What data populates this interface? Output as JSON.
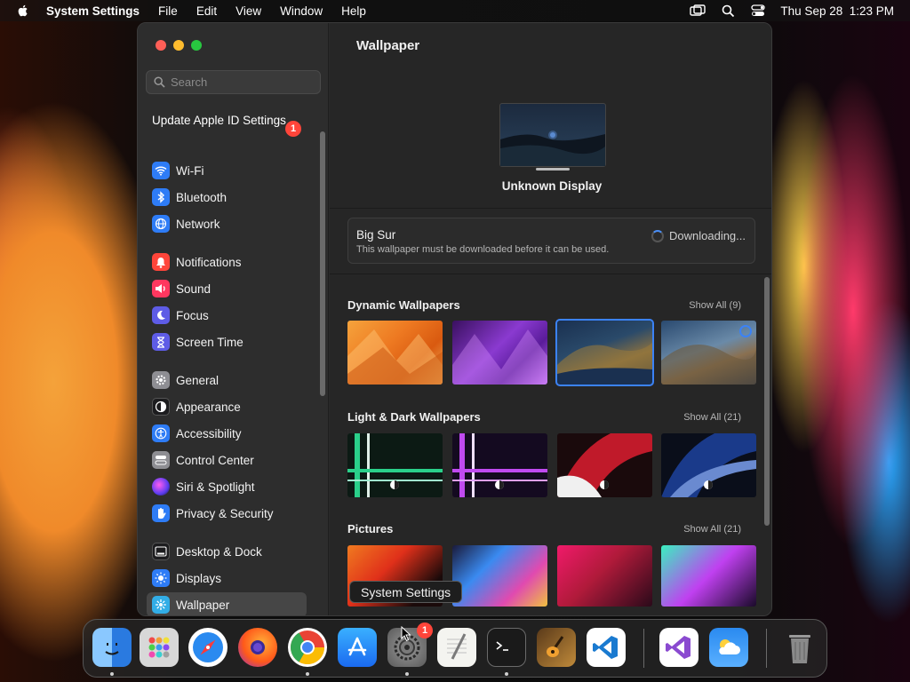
{
  "menubar": {
    "app_name": "System Settings",
    "items": [
      "File",
      "Edit",
      "View",
      "Window",
      "Help"
    ],
    "datetime": "Thu Sep 28  1:23 PM",
    "icons": [
      "apple-icon",
      "screen-mirroring-icon",
      "spotlight-search-icon",
      "control-center-icon"
    ]
  },
  "sidebar": {
    "search_placeholder": "Search",
    "update_item": {
      "label": "Update Apple ID Settings",
      "badge": "1"
    },
    "items": [
      {
        "label": "Wi-Fi",
        "icon": "wifi-icon",
        "color": "#2e7cf6"
      },
      {
        "label": "Bluetooth",
        "icon": "bluetooth-icon",
        "color": "#2e7cf6"
      },
      {
        "label": "Network",
        "icon": "globe-icon",
        "color": "#2e7cf6"
      },
      {
        "label": "Notifications",
        "icon": "bell-icon",
        "color": "#ff453a"
      },
      {
        "label": "Sound",
        "icon": "speaker-icon",
        "color": "#ff375f"
      },
      {
        "label": "Focus",
        "icon": "moon-icon",
        "color": "#5e5ce6"
      },
      {
        "label": "Screen Time",
        "icon": "hourglass-icon",
        "color": "#5e5ce6"
      },
      {
        "label": "General",
        "icon": "gear-icon",
        "color": "#8e8e93"
      },
      {
        "label": "Appearance",
        "icon": "appearance-icon",
        "color": "#1c1c1e"
      },
      {
        "label": "Accessibility",
        "icon": "accessibility-icon",
        "color": "#2e7cf6"
      },
      {
        "label": "Control Center",
        "icon": "toggles-icon",
        "color": "#8e8e93"
      },
      {
        "label": "Siri & Spotlight",
        "icon": "siri-icon",
        "color": "#bf5af2"
      },
      {
        "label": "Privacy & Security",
        "icon": "hand-icon",
        "color": "#2e7cf6"
      },
      {
        "label": "Desktop & Dock",
        "icon": "dock-icon",
        "color": "#1c1c1e"
      },
      {
        "label": "Displays",
        "icon": "sun-icon",
        "color": "#2e7cf6"
      },
      {
        "label": "Wallpaper",
        "icon": "wallpaper-icon",
        "color": "#32ade6"
      }
    ],
    "selected": "Wallpaper"
  },
  "main": {
    "title": "Wallpaper",
    "display_label": "Unknown Display",
    "notice": {
      "title": "Big Sur",
      "description": "This wallpaper must be downloaded before it can be used.",
      "status": "Downloading..."
    },
    "sections": [
      {
        "title": "Dynamic Wallpapers",
        "show_all": "Show All (9)"
      },
      {
        "title": "Light & Dark Wallpapers",
        "show_all": "Show All (21)"
      },
      {
        "title": "Pictures",
        "show_all": "Show All (21)"
      }
    ]
  },
  "tooltip": "System Settings",
  "dock": {
    "apps": [
      "Finder",
      "Launchpad",
      "Safari",
      "Firefox",
      "Chrome",
      "App Store",
      "System Settings",
      "TextEdit",
      "Terminal",
      "GarageBand",
      "Visual Studio Code",
      "Visual Studio",
      "Weather",
      "Trash"
    ],
    "system_settings_badge": "1"
  }
}
